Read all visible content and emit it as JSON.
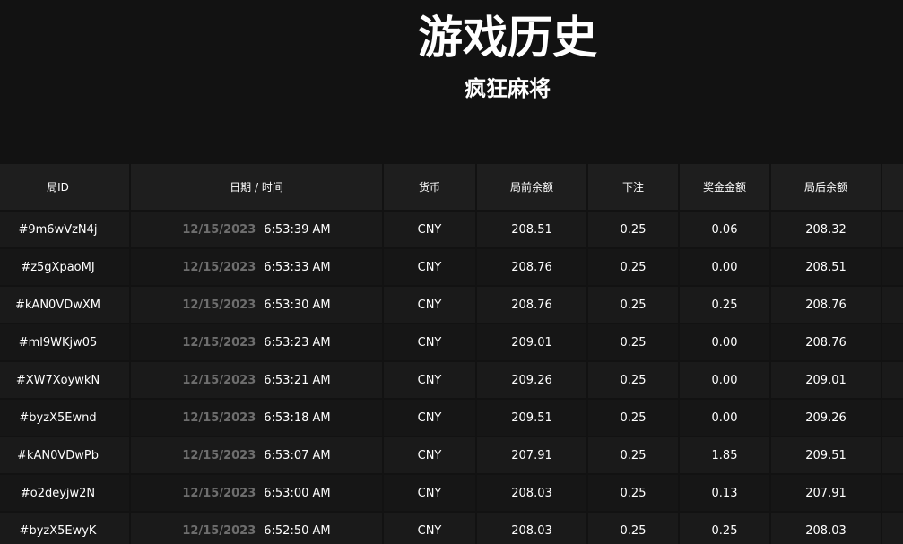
{
  "header": {
    "title": "游戏历史",
    "subtitle": "疯狂麻将"
  },
  "table": {
    "columns": [
      "局ID",
      "日期 / 时间",
      "货币",
      "局前余额",
      "下注",
      "奖金金额",
      "局后余额",
      ""
    ],
    "rows": [
      {
        "id": "#9m6wVzN4j",
        "date": "12/15/2023",
        "time": "6:53:39 AM",
        "currency": "CNY",
        "before": "208.51",
        "bet": "0.25",
        "prize": "0.06",
        "after": "208.32"
      },
      {
        "id": "#z5gXpaoMJ",
        "date": "12/15/2023",
        "time": "6:53:33 AM",
        "currency": "CNY",
        "before": "208.76",
        "bet": "0.25",
        "prize": "0.00",
        "after": "208.51"
      },
      {
        "id": "#kAN0VDwXM",
        "date": "12/15/2023",
        "time": "6:53:30 AM",
        "currency": "CNY",
        "before": "208.76",
        "bet": "0.25",
        "prize": "0.25",
        "after": "208.76"
      },
      {
        "id": "#ml9WKjw05",
        "date": "12/15/2023",
        "time": "6:53:23 AM",
        "currency": "CNY",
        "before": "209.01",
        "bet": "0.25",
        "prize": "0.00",
        "after": "208.76"
      },
      {
        "id": "#XW7XoywkN",
        "date": "12/15/2023",
        "time": "6:53:21 AM",
        "currency": "CNY",
        "before": "209.26",
        "bet": "0.25",
        "prize": "0.00",
        "after": "209.01"
      },
      {
        "id": "#byzX5Ewnd",
        "date": "12/15/2023",
        "time": "6:53:18 AM",
        "currency": "CNY",
        "before": "209.51",
        "bet": "0.25",
        "prize": "0.00",
        "after": "209.26"
      },
      {
        "id": "#kAN0VDwPb",
        "date": "12/15/2023",
        "time": "6:53:07 AM",
        "currency": "CNY",
        "before": "207.91",
        "bet": "0.25",
        "prize": "1.85",
        "after": "209.51"
      },
      {
        "id": "#o2deyjw2N",
        "date": "12/15/2023",
        "time": "6:53:00 AM",
        "currency": "CNY",
        "before": "208.03",
        "bet": "0.25",
        "prize": "0.13",
        "after": "207.91"
      },
      {
        "id": "#byzX5EwyK",
        "date": "12/15/2023",
        "time": "6:52:50 AM",
        "currency": "CNY",
        "before": "208.03",
        "bet": "0.25",
        "prize": "0.25",
        "after": "208.03"
      }
    ]
  }
}
